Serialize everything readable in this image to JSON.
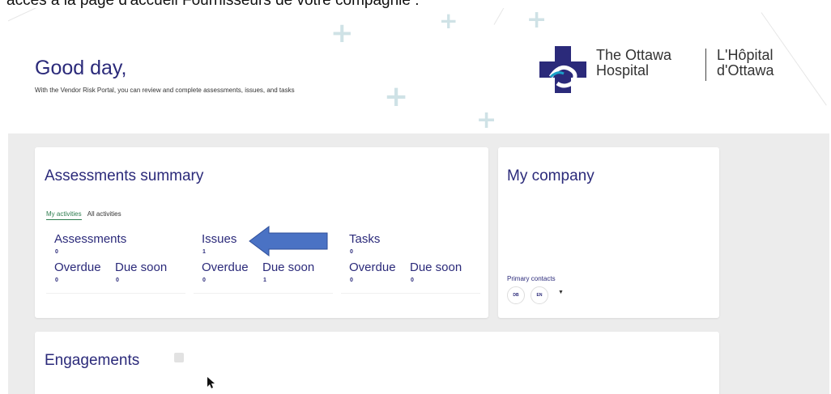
{
  "caption": "accès à la page d'accueil Fournisseurs de votre compagnie :",
  "hero": {
    "greeting": "Good day,",
    "subtitle": "With the Vendor Risk Portal, you can review and complete assessments, issues, and tasks"
  },
  "logo": {
    "line1_en": "The Ottawa",
    "line2_en": "Hospital",
    "line1_fr": "L'Hôpital",
    "line2_fr": "d'Ottawa",
    "colors": {
      "mark": "#2b2a7a",
      "accent": "#1aa0c8"
    }
  },
  "assessments_summary": {
    "title": "Assessments summary",
    "tabs": [
      {
        "label": "My activities",
        "active": true
      },
      {
        "label": "All activities",
        "active": false
      }
    ],
    "stats": [
      {
        "label": "Assessments",
        "count": "0",
        "overdue_label": "Overdue",
        "overdue": "0",
        "due_soon_label": "Due soon",
        "due_soon": "0"
      },
      {
        "label": "Issues",
        "count": "1",
        "overdue_label": "Overdue",
        "overdue": "0",
        "due_soon_label": "Due soon",
        "due_soon": "1"
      },
      {
        "label": "Tasks",
        "count": "0",
        "overdue_label": "Overdue",
        "overdue": "0",
        "due_soon_label": "Due soon",
        "due_soon": "0"
      }
    ]
  },
  "my_company": {
    "title": "My company",
    "primary_contacts_label": "Primary contacts",
    "contacts": [
      "DB",
      "EN"
    ]
  },
  "engagements": {
    "title": "Engagements"
  },
  "colors": {
    "heading": "#2b2a7a",
    "active_tab": "#2e7d4f",
    "arrow_fill": "#4a72c4",
    "background": "#ececec"
  }
}
